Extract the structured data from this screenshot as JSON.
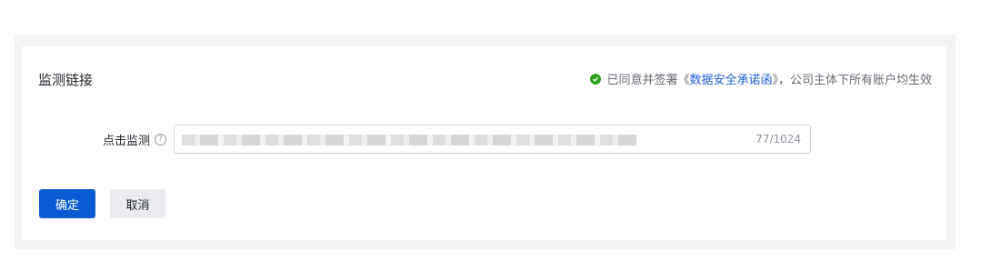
{
  "section": {
    "title": "监测链接",
    "notice_prefix": "已同意并签署《",
    "notice_link": "数据安全承诺函",
    "notice_suffix": "》，公司主体下所有账户均生效",
    "check_icon": "check-circle-icon"
  },
  "form": {
    "click_monitor_label": "点击监测",
    "help_icon": "question-circle-icon",
    "char_count": "77/1024"
  },
  "actions": {
    "confirm_label": "确定",
    "cancel_label": "取消"
  },
  "colors": {
    "primary": "#0a5bd3",
    "success": "#2ea121",
    "link": "#1f5fd6"
  }
}
